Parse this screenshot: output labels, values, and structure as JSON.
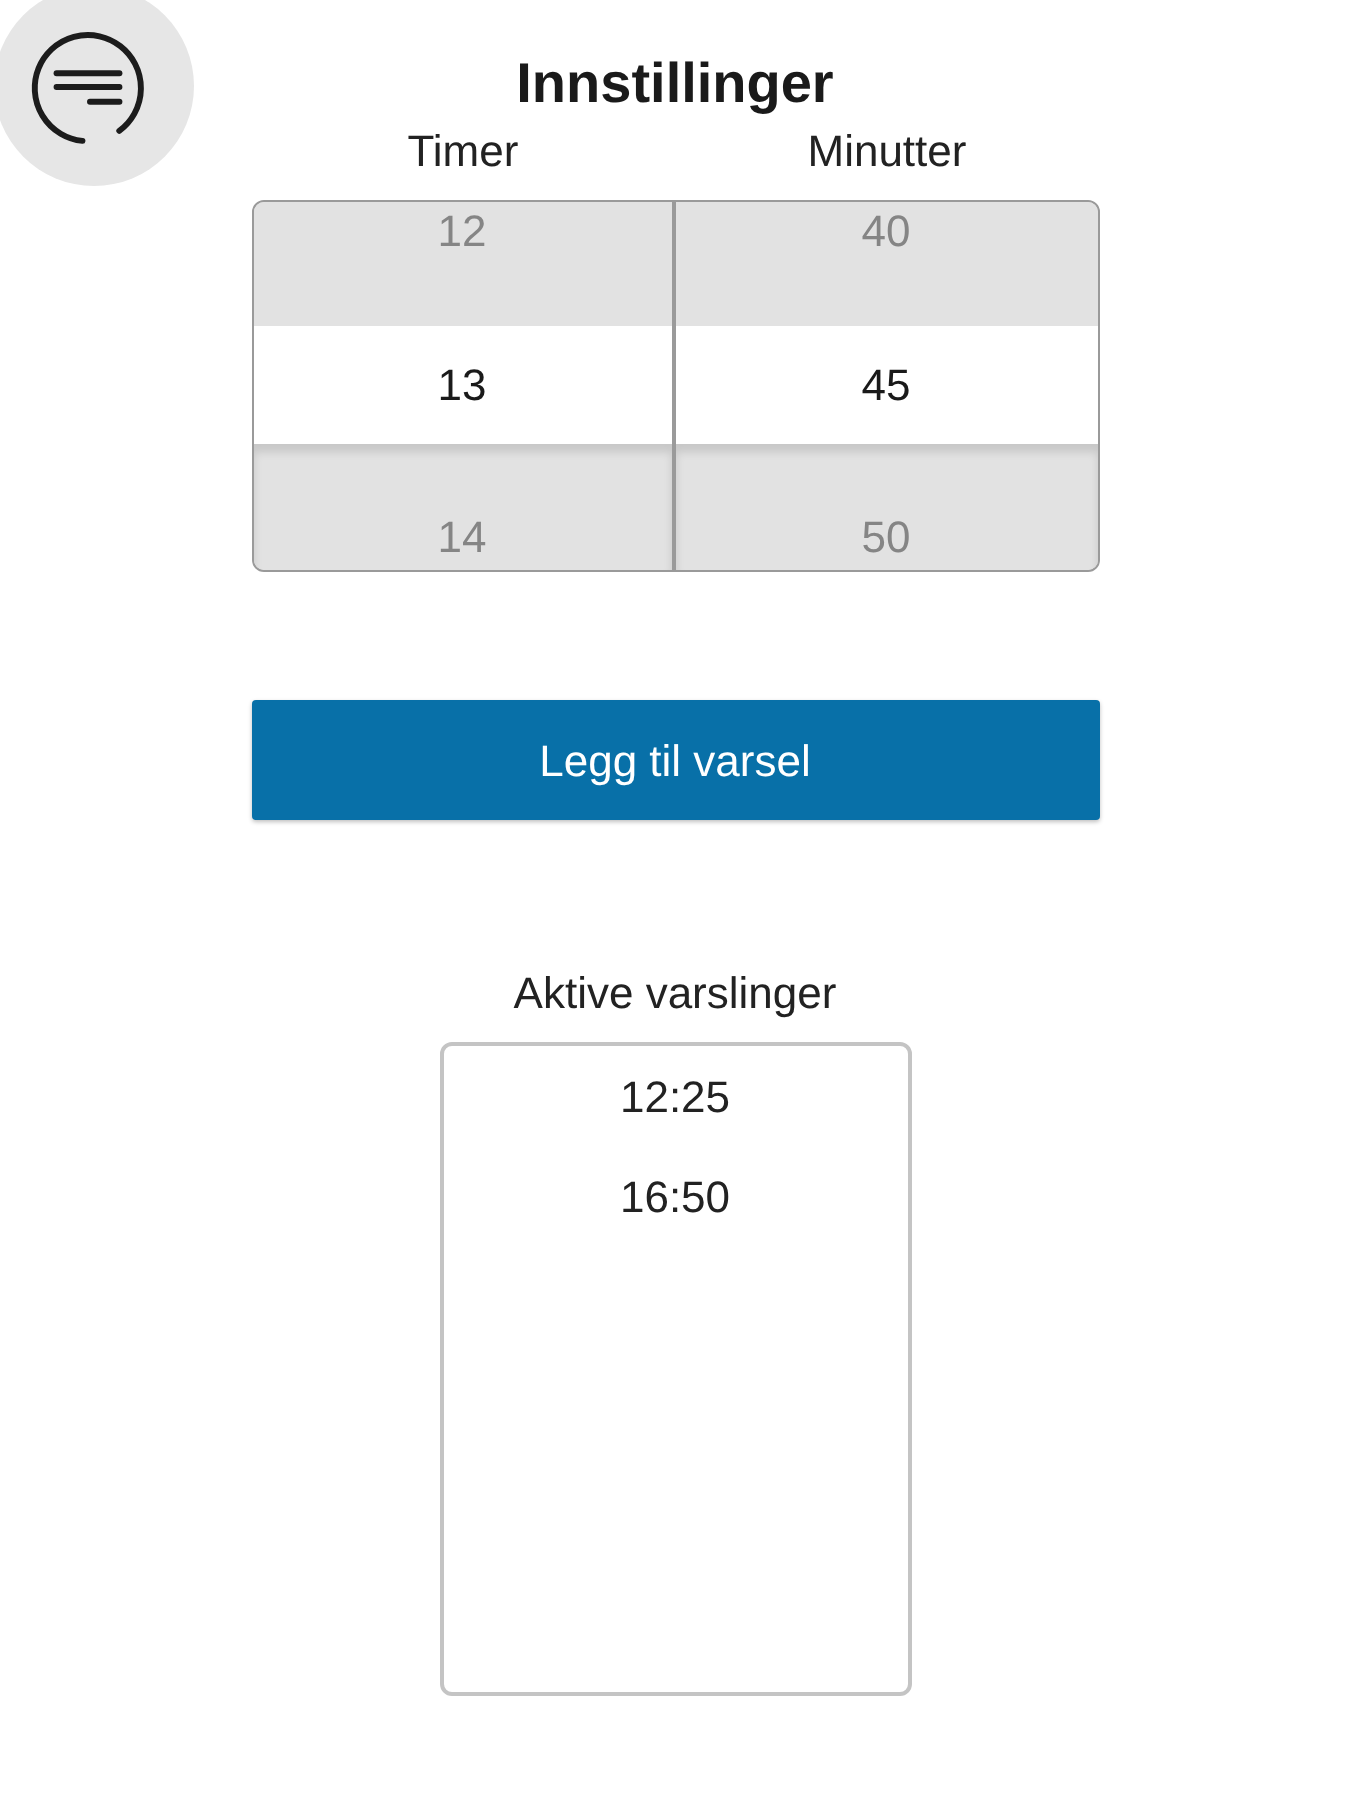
{
  "title": "Innstillinger",
  "picker": {
    "columns": [
      {
        "label": "Timer",
        "options": [
          {
            "text": "12",
            "selected": false
          },
          {
            "text": "13",
            "selected": true
          },
          {
            "text": "14",
            "selected": false
          }
        ]
      },
      {
        "label": "Minutter",
        "options": [
          {
            "text": "40",
            "selected": false
          },
          {
            "text": "45",
            "selected": true
          },
          {
            "text": "50",
            "selected": false
          }
        ]
      }
    ]
  },
  "add_button": {
    "label": "Legg til varsel"
  },
  "active_alerts": {
    "label": "Aktive varslinger",
    "items": [
      "12:25",
      "16:50"
    ]
  }
}
